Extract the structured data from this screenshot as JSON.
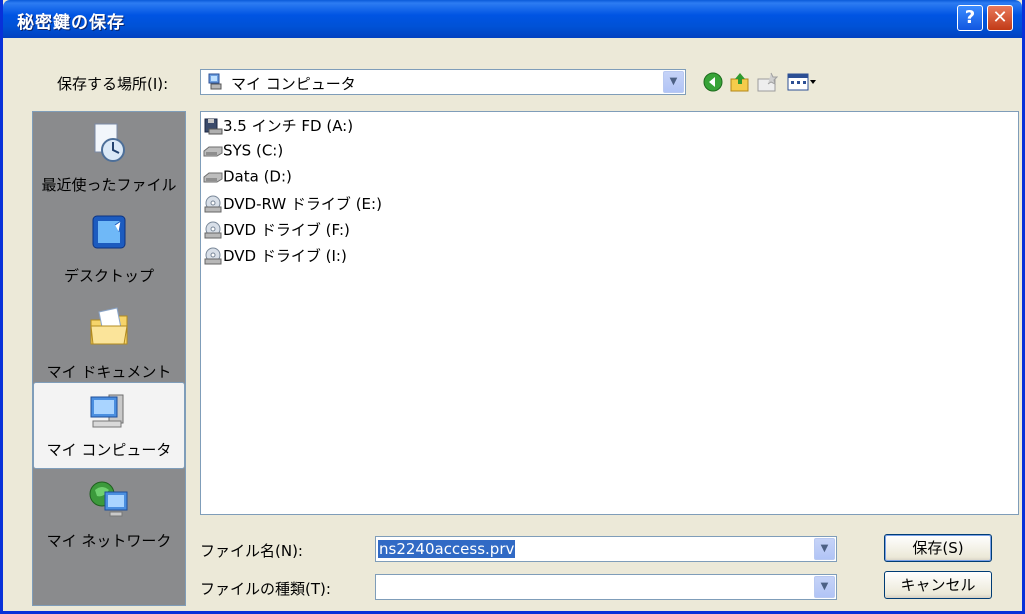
{
  "window": {
    "title": "秘密鍵の保存"
  },
  "toolbar": {
    "save_in_label": "保存する場所(I):",
    "location_value": "マイ コンピュータ",
    "back_icon": "back-arrow-icon",
    "up_icon": "up-folder-icon",
    "new_folder_icon": "new-folder-icon",
    "views_icon": "views-menu-icon"
  },
  "places": [
    {
      "label": "最近使ったファイル",
      "icon": "recent-files-icon"
    },
    {
      "label": "デスクトップ",
      "icon": "desktop-icon"
    },
    {
      "label": "マイ ドキュメント",
      "icon": "my-documents-icon"
    },
    {
      "label": "マイ コンピュータ",
      "icon": "my-computer-icon",
      "selected": true
    },
    {
      "label": "マイ ネットワーク",
      "icon": "my-network-icon"
    }
  ],
  "files": [
    {
      "label": "3.5 インチ FD (A:)",
      "icon": "floppy-drive-icon"
    },
    {
      "label": "SYS (C:)",
      "icon": "hard-drive-icon"
    },
    {
      "label": "Data (D:)",
      "icon": "hard-drive-icon"
    },
    {
      "label": "DVD-RW ドライブ (E:)",
      "icon": "dvd-drive-icon"
    },
    {
      "label": "DVD ドライブ (F:)",
      "icon": "dvd-drive-icon"
    },
    {
      "label": "DVD ドライブ (I:)",
      "icon": "dvd-drive-icon"
    }
  ],
  "form": {
    "filename_label": "ファイル名(N):",
    "filename_value": "ns2240access.prv",
    "filetype_label": "ファイルの種類(T):",
    "filetype_value": ""
  },
  "buttons": {
    "save": "保存(S)",
    "cancel": "キャンセル"
  },
  "colors": {
    "title_bar": "#0054e3",
    "dialog_bg": "#ece9d8",
    "selection": "#316ac5",
    "places_bg": "#8a8b8d"
  }
}
